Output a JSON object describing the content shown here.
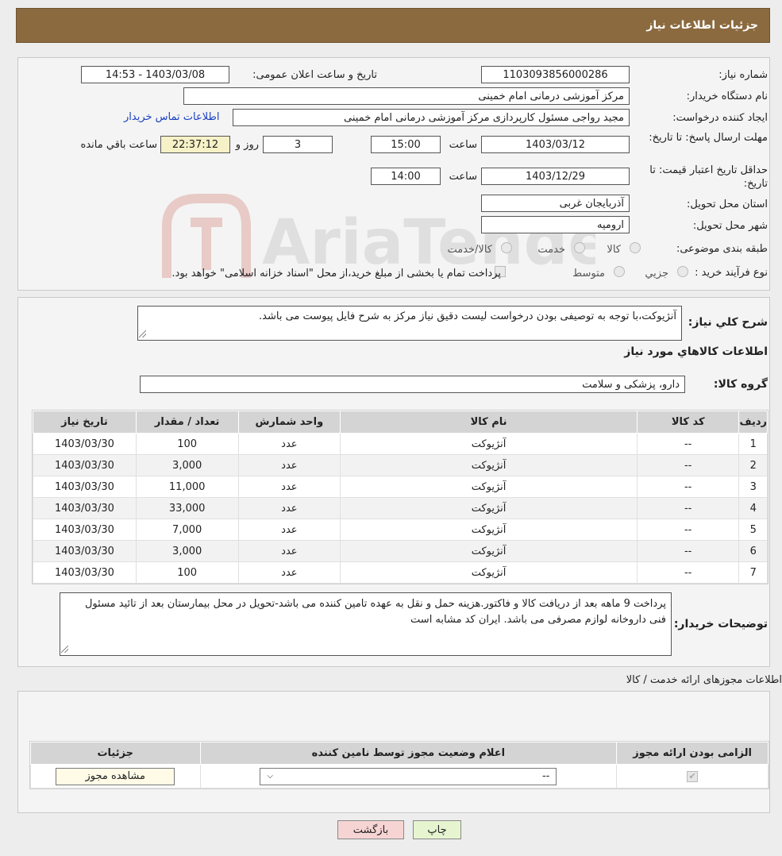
{
  "header": {
    "title": "جزئیات اطلاعات نیاز"
  },
  "info": {
    "need_number_label": "شماره نیاز:",
    "need_number": "1103093856000286",
    "announce_label": "تاریخ و ساعت اعلان عمومی:",
    "announce_value": "1403/03/08 - 14:53",
    "buyer_org_label": "نام دستگاه خریدار:",
    "buyer_org": "مرکز آموزشی درمانی امام خمینی",
    "creator_label": "ایجاد کننده درخواست:",
    "creator": "مجید  رواجی مسئول کارپردازی مرکز آموزشی درمانی امام خمینی",
    "contact_link": "اطلاعات تماس خریدار",
    "reply_deadline_label": "مهلت ارسال پاسخ: تا تاریخ:",
    "reply_date": "1403/03/12",
    "time_label": "ساعت",
    "reply_time": "15:00",
    "days": "3",
    "days_label": "روز و",
    "remaining_time": "22:37:12",
    "remaining_label": "ساعت باقي مانده",
    "validity_label": "حداقل تاریخ اعتبار قیمت: تا تاریخ:",
    "validity_date": "1403/12/29",
    "validity_time": "14:00",
    "province_label": "استان محل تحویل:",
    "province": "آذربایجان غربی",
    "city_label": "شهر محل تحویل:",
    "city": "ارومیه",
    "category_label": "طبقه بندی موضوعی:",
    "category_options": [
      "کالا",
      "خدمت",
      "کالا/خدمت"
    ],
    "process_label": "نوع فرآیند خرید :",
    "process_options": [
      "جزيي",
      "متوسط"
    ],
    "process_note": "پرداخت تمام یا بخشی از مبلغ خرید،از محل \"اسناد خزانه اسلامی\" خواهد بود."
  },
  "description": {
    "label": "شرح کلي نیاز:",
    "text": "آنژیوکت،با توجه به توصیفی بودن درخواست لیست دقیق نیاز مرکز به شرح فایل پیوست می باشد."
  },
  "goods": {
    "section_title": "اطلاعات کالاهاي مورد نیاز",
    "group_label": "گروه کالا:",
    "group_value": "دارو، پزشکی و سلامت",
    "columns": [
      "ردیف",
      "کد کالا",
      "نام کالا",
      "واحد شمارش",
      "تعداد / مقدار",
      "تاریخ نیاز"
    ],
    "rows": [
      [
        "1",
        "--",
        "آنژیوکت",
        "عدد",
        "100",
        "1403/03/30"
      ],
      [
        "2",
        "--",
        "آنژیوکت",
        "عدد",
        "3,000",
        "1403/03/30"
      ],
      [
        "3",
        "--",
        "آنژیوکت",
        "عدد",
        "11,000",
        "1403/03/30"
      ],
      [
        "4",
        "--",
        "آنژیوکت",
        "عدد",
        "33,000",
        "1403/03/30"
      ],
      [
        "5",
        "--",
        "آنژیوکت",
        "عدد",
        "7,000",
        "1403/03/30"
      ],
      [
        "6",
        "--",
        "آنژیوکت",
        "عدد",
        "3,000",
        "1403/03/30"
      ],
      [
        "7",
        "--",
        "آنژیوکت",
        "عدد",
        "100",
        "1403/03/30"
      ]
    ]
  },
  "buyer_notes": {
    "label": "توضیحات خریدار:",
    "text": "پرداخت   9   ماهه بعد از دریافت کالا و فاکتور.هزینه حمل و نقل به عهده تامین کننده می باشد-تحویل در محل بیمارستان بعد از تائید مسئول فنی داروخانه لوازم مصرفی می باشد. ایران کد مشابه است"
  },
  "permits": {
    "section_title": "اطلاعات مجوزهای ارائه خدمت / کالا",
    "columns": [
      "الزامی بودن ارائه مجوز",
      "اعلام وضعیت مجوز توسط نامین کننده",
      "جزئیات"
    ],
    "select_value": "--",
    "view_button": "مشاهده مجوز"
  },
  "footer": {
    "print_button": "چاپ",
    "back_button": "بازگشت"
  },
  "watermark": {
    "text": "AriaTender.neT"
  },
  "colors": {
    "header_bg": "#8b6a3f",
    "link": "#1a3fc4",
    "back_bg": "#f7d4d4",
    "print_bg": "#e6f5d0"
  }
}
